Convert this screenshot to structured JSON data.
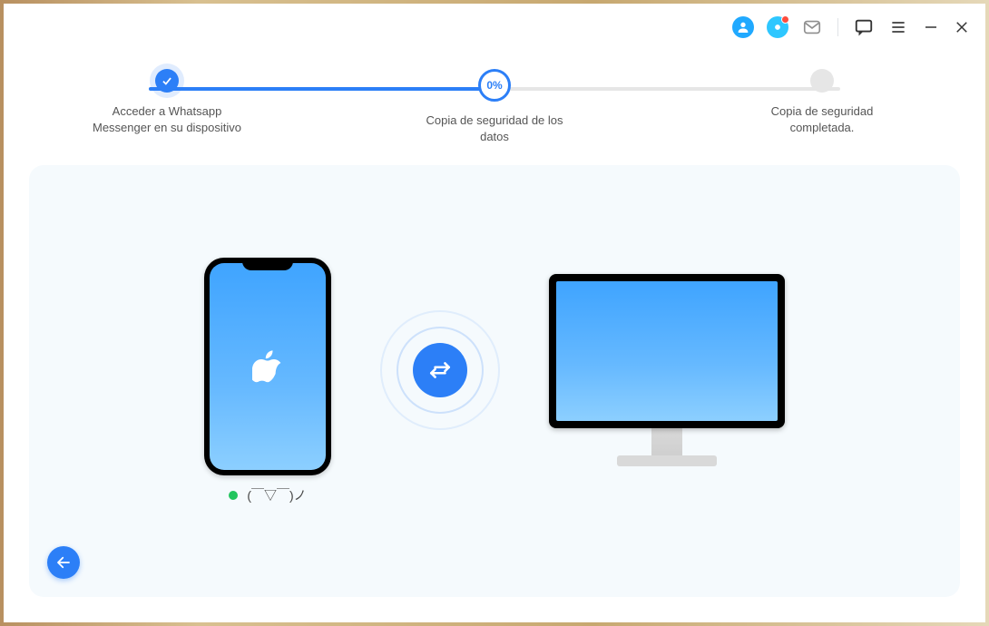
{
  "progress": {
    "steps": [
      {
        "label": "Acceder a Whatsapp Messenger en su dispositivo",
        "state": "done"
      },
      {
        "label": "Copia de seguridad de los datos",
        "state": "active",
        "value": "0%"
      },
      {
        "label": "Copia de seguridad completada.",
        "state": "pending"
      }
    ]
  },
  "device": {
    "name": "(￣▽￣)ノ",
    "connected": true
  },
  "icons": {
    "account": "account-icon",
    "cloud": "cloud-icon",
    "mail": "mail-icon",
    "feedback": "feedback-icon",
    "menu": "menu-icon",
    "minimize": "minimize-icon",
    "close": "close-icon",
    "back": "back-icon",
    "transfer": "transfer-icon"
  }
}
